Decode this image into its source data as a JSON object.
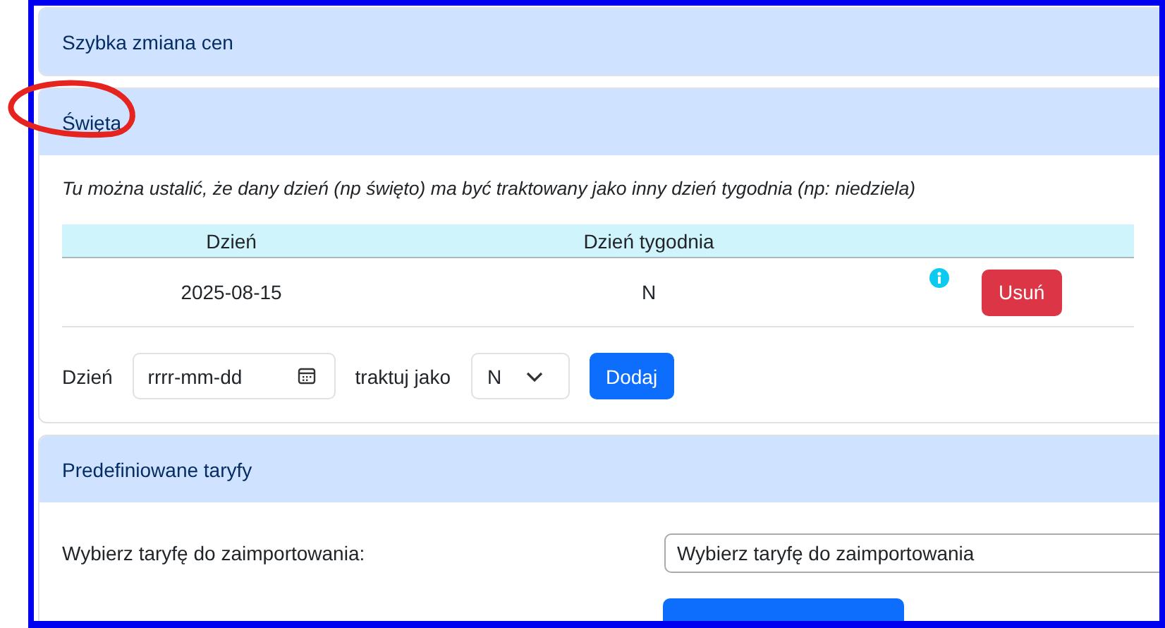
{
  "sections": [
    {
      "kind": "collapsed",
      "title": "Szybka zmiana cen"
    },
    {
      "kind": "holidays",
      "title": "Święta",
      "annotated": true,
      "note": "Tu można ustalić, że dany dzień (np święto) ma być traktowany jako inny dzień tygodnia (np: niedziela)",
      "columns": [
        "Dzień",
        "Dzień tygodnia"
      ],
      "rows": [
        {
          "date": "2025-08-15",
          "weekday": "N",
          "action": "Usuń"
        }
      ],
      "form": {
        "date_label": "Dzień",
        "date_placeholder": "rrrr-mm-dd",
        "as_label": "traktuj jako",
        "weekday_value": "N",
        "button": "Dodaj"
      }
    },
    {
      "kind": "tariffs",
      "title": "Predefiniowane taryfy",
      "label": "Wybierz taryfę do zaimportowania:",
      "select_value": "Wybierz taryfę do zaimportowania"
    }
  ]
}
